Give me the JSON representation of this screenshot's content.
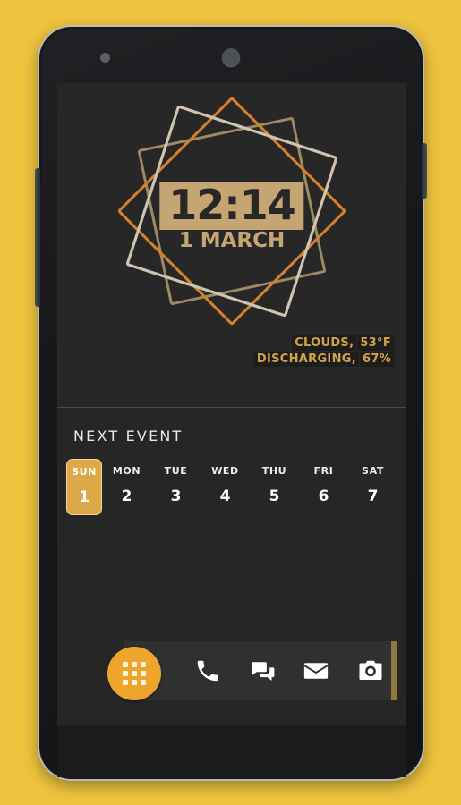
{
  "device": {
    "frame_color": "#17181a",
    "bezel_color": "#b9bbb6",
    "background_color": "#eec33e",
    "buttons": [
      {
        "name": "volume-rocker",
        "side": "left"
      },
      {
        "name": "power-button",
        "side": "right"
      }
    ],
    "sensors": [
      {
        "name": "sensor-dot"
      },
      {
        "name": "front-camera"
      }
    ]
  },
  "clock_widget": {
    "time": "12:14",
    "date": "1 MARCH",
    "time_plate_color": "#c5a572",
    "date_color": "#c5a572",
    "rings": [
      {
        "name": "ring-square-cream",
        "color": "#cfc4b0"
      },
      {
        "name": "ring-square-orange",
        "color": "#d4802e"
      },
      {
        "name": "ring-square-gold",
        "color": "#9c8a64"
      }
    ]
  },
  "status": {
    "weather_label": "CLOUDS,",
    "temperature": "53°F",
    "battery_label": "DISCHARGING,",
    "battery_level": "67%",
    "accent_color": "#d2a24a"
  },
  "calendar": {
    "title": "NEXT EVENT",
    "selected_index": 0,
    "selected_color": "#dda848",
    "days": [
      {
        "name": "SUN",
        "num": "1"
      },
      {
        "name": "MON",
        "num": "2"
      },
      {
        "name": "TUE",
        "num": "3"
      },
      {
        "name": "WED",
        "num": "4"
      },
      {
        "name": "THU",
        "num": "5"
      },
      {
        "name": "FRI",
        "num": "6"
      },
      {
        "name": "SAT",
        "num": "7"
      }
    ]
  },
  "dock": {
    "accent_color": "#eda52c",
    "page_indicator_color": "#8e7a3f",
    "app_drawer": {
      "icon": "app-drawer-grid-icon"
    },
    "items": [
      {
        "icon": "phone-icon",
        "label": "Phone"
      },
      {
        "icon": "messages-icon",
        "label": "Messages"
      },
      {
        "icon": "email-icon",
        "label": "Email"
      },
      {
        "icon": "camera-icon",
        "label": "Camera"
      }
    ]
  }
}
